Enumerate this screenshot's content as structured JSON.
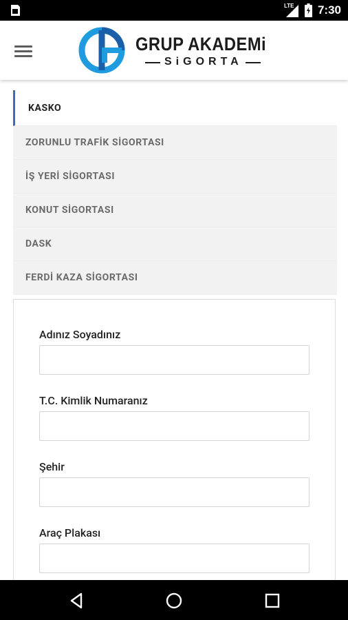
{
  "status_bar": {
    "time": "7:30",
    "network": "LTE",
    "icons": [
      "sim-card-icon",
      "signal-icon",
      "battery-icon"
    ]
  },
  "header": {
    "logo_title": "GRUP AKADEMi",
    "logo_subtitle": "SiGORTA",
    "icons": [
      "hamburger-menu-icon",
      "logo-mark-icon"
    ]
  },
  "tabs": [
    {
      "label": "KASKO",
      "active": true
    },
    {
      "label": "ZORUNLU TRAFİK SİGORTASI",
      "active": false
    },
    {
      "label": "İŞ YERİ SİGORTASI",
      "active": false
    },
    {
      "label": "KONUT SİGORTASI",
      "active": false
    },
    {
      "label": "DASK",
      "active": false
    },
    {
      "label": "FERDİ KAZA SİGORTASI",
      "active": false
    }
  ],
  "form": {
    "fields": [
      {
        "label": "Adınız Soyadınız",
        "value": ""
      },
      {
        "label": "T.C. Kimlik Numaranız",
        "value": ""
      },
      {
        "label": "Şehir",
        "value": ""
      },
      {
        "label": "Araç Plakası",
        "value": ""
      }
    ]
  },
  "nav_bar": {
    "icons": [
      "back-icon",
      "home-icon",
      "recents-icon"
    ]
  },
  "colors": {
    "accent": "#3b6eb5",
    "logo_blue": "#1f9be0",
    "logo_dark_blue": "#1b5fa8",
    "tab_bg": "#f2f2f2"
  }
}
